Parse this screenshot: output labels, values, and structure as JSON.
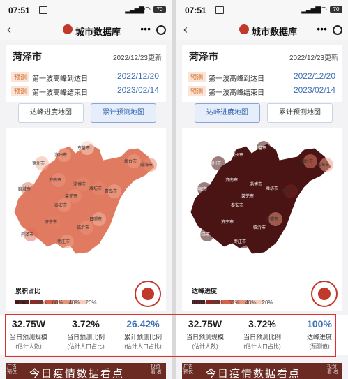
{
  "status": {
    "time": "07:51",
    "battery": "70"
  },
  "nav": {
    "title": "城市数据库",
    "back": "‹",
    "more": "•••"
  },
  "header": {
    "city": "菏泽市",
    "update": "2022/12/23更新",
    "rows": [
      {
        "tag": "预测",
        "label": "第一波高峰到达日",
        "date": "2022/12/20"
      },
      {
        "tag": "预测",
        "label": "第一波高峰结束日",
        "date": "2023/02/14"
      }
    ]
  },
  "tabs": [
    "达峰进度地图",
    "累计预测地图"
  ],
  "panels": [
    {
      "active_tab": 1,
      "legend_title": "累积占比",
      "legend_labels": [
        "100%",
        "80%",
        "60%",
        "40%",
        "20%"
      ],
      "legend_colors": [
        "#4b1414",
        "#8e2a20",
        "#d4614a",
        "#e8937c",
        "#f6cdbd"
      ],
      "stats": [
        {
          "value": "32.75W",
          "name": "当日预测规模",
          "sub": "(估计人数)",
          "blue": false
        },
        {
          "value": "3.72%",
          "name": "当日预测比例",
          "sub": "(估计人口占比)",
          "blue": false
        },
        {
          "value": "26.42%",
          "name": "累计预测比例",
          "sub": "(估计人口占比)",
          "blue": true
        }
      ]
    },
    {
      "active_tab": 0,
      "legend_title": "达峰进度",
      "legend_labels": [
        "100%",
        "80%",
        "60%",
        "40%",
        "20%"
      ],
      "legend_colors": [
        "#4b1414",
        "#8e2a20",
        "#d4614a",
        "#e8937c",
        "#f6cdbd"
      ],
      "stats": [
        {
          "value": "32.75W",
          "name": "当日预测规模",
          "sub": "(估计人数)",
          "blue": false
        },
        {
          "value": "3.72%",
          "name": "当日预测比例",
          "sub": "(估计人口占比)",
          "blue": false
        },
        {
          "value": "100%",
          "name": "达峰进度",
          "sub": "(预测值)",
          "blue": true
        }
      ]
    }
  ],
  "map_cities": [
    "德州市",
    "滨州市",
    "东营市",
    "烟台市",
    "威海市",
    "聊城市",
    "济南市",
    "淄博市",
    "潍坊市",
    "青岛市",
    "莱芜市",
    "泰安市",
    "日照市",
    "济宁市",
    "临沂市",
    "菏泽市",
    "枣庄市"
  ],
  "banner": {
    "text": "今日疫情数据看点",
    "left": "广告 预仅",
    "right": "投资看 者"
  }
}
